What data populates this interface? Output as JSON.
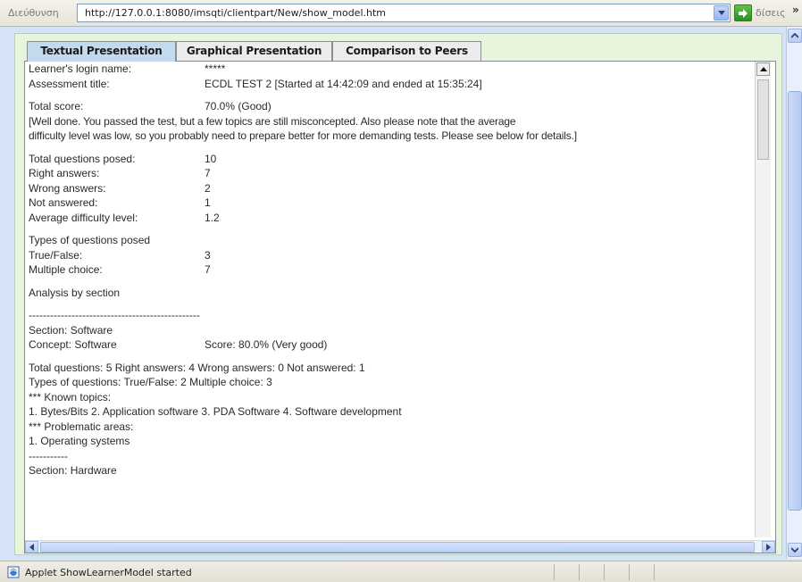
{
  "address_bar": {
    "label": "Διεύθυνση",
    "url": "http://127.0.0.1:8080/imsqti/clientpart/New/show_model.htm",
    "go_label": "δίσεις",
    "chevrons": "»"
  },
  "tabs": [
    {
      "label": "Textual Presentation",
      "active": true
    },
    {
      "label": "Graphical Presentation",
      "active": false
    },
    {
      "label": "Comparison to Peers",
      "active": false
    }
  ],
  "report": {
    "login_label": "Learner's login name:",
    "login_value": "*****",
    "title_label": "Assessment title:",
    "title_value": "ECDL TEST 2   [Started at 14:42:09  and ended at  15:35:24]",
    "score_label": "Total score:",
    "score_value": "70.0%  (Good)",
    "comment_line1": "[Well done. You passed the test, but a few topics are still misconcepted. Also please note that the average",
    "comment_line2": "difficulty level was low, so you probably need to prepare better for more demanding tests. Please see below for details.]",
    "stats": [
      {
        "label": "Total questions posed:",
        "value": "10"
      },
      {
        "label": "Right answers:",
        "value": "7"
      },
      {
        "label": "Wrong answers:",
        "value": "2"
      },
      {
        "label": "Not answered:",
        "value": "1"
      },
      {
        "label": "Average difficulty level:",
        "value": "1.2"
      }
    ],
    "types_heading": "Types of questions posed",
    "types": [
      {
        "label": "True/False:",
        "value": "3"
      },
      {
        "label": "Multiple choice:",
        "value": "7"
      }
    ],
    "analysis_heading": "Analysis by section",
    "separator_long": "------------------------------------------------",
    "section1": {
      "section_line": "Section:  Software",
      "concept_label": "Concept:  Software",
      "concept_score": "Score:  80.0% (Very good)",
      "totals_line": "Total questions:  5    Right answers:  4    Wrong answers:  0    Not answered:  1",
      "types_line": "Types of questions:   True/False:  2    Multiple choice:  3",
      "known_heading": "*** Known topics:",
      "known_list": "1. Bytes/Bits   2. Application software   3. PDA Software   4. Software development",
      "problem_heading": "*** Problematic areas:",
      "problem_list": "1. Operating systems"
    },
    "separator_short": "-----------",
    "section2_line": "Section:  Hardware"
  },
  "status_bar": {
    "text": "Applet ShowLearnerModel started"
  },
  "colors": {
    "applet_bg": "#e6f5db",
    "active_tab": "#c3d9ee",
    "inactive_tab": "#ececec"
  }
}
